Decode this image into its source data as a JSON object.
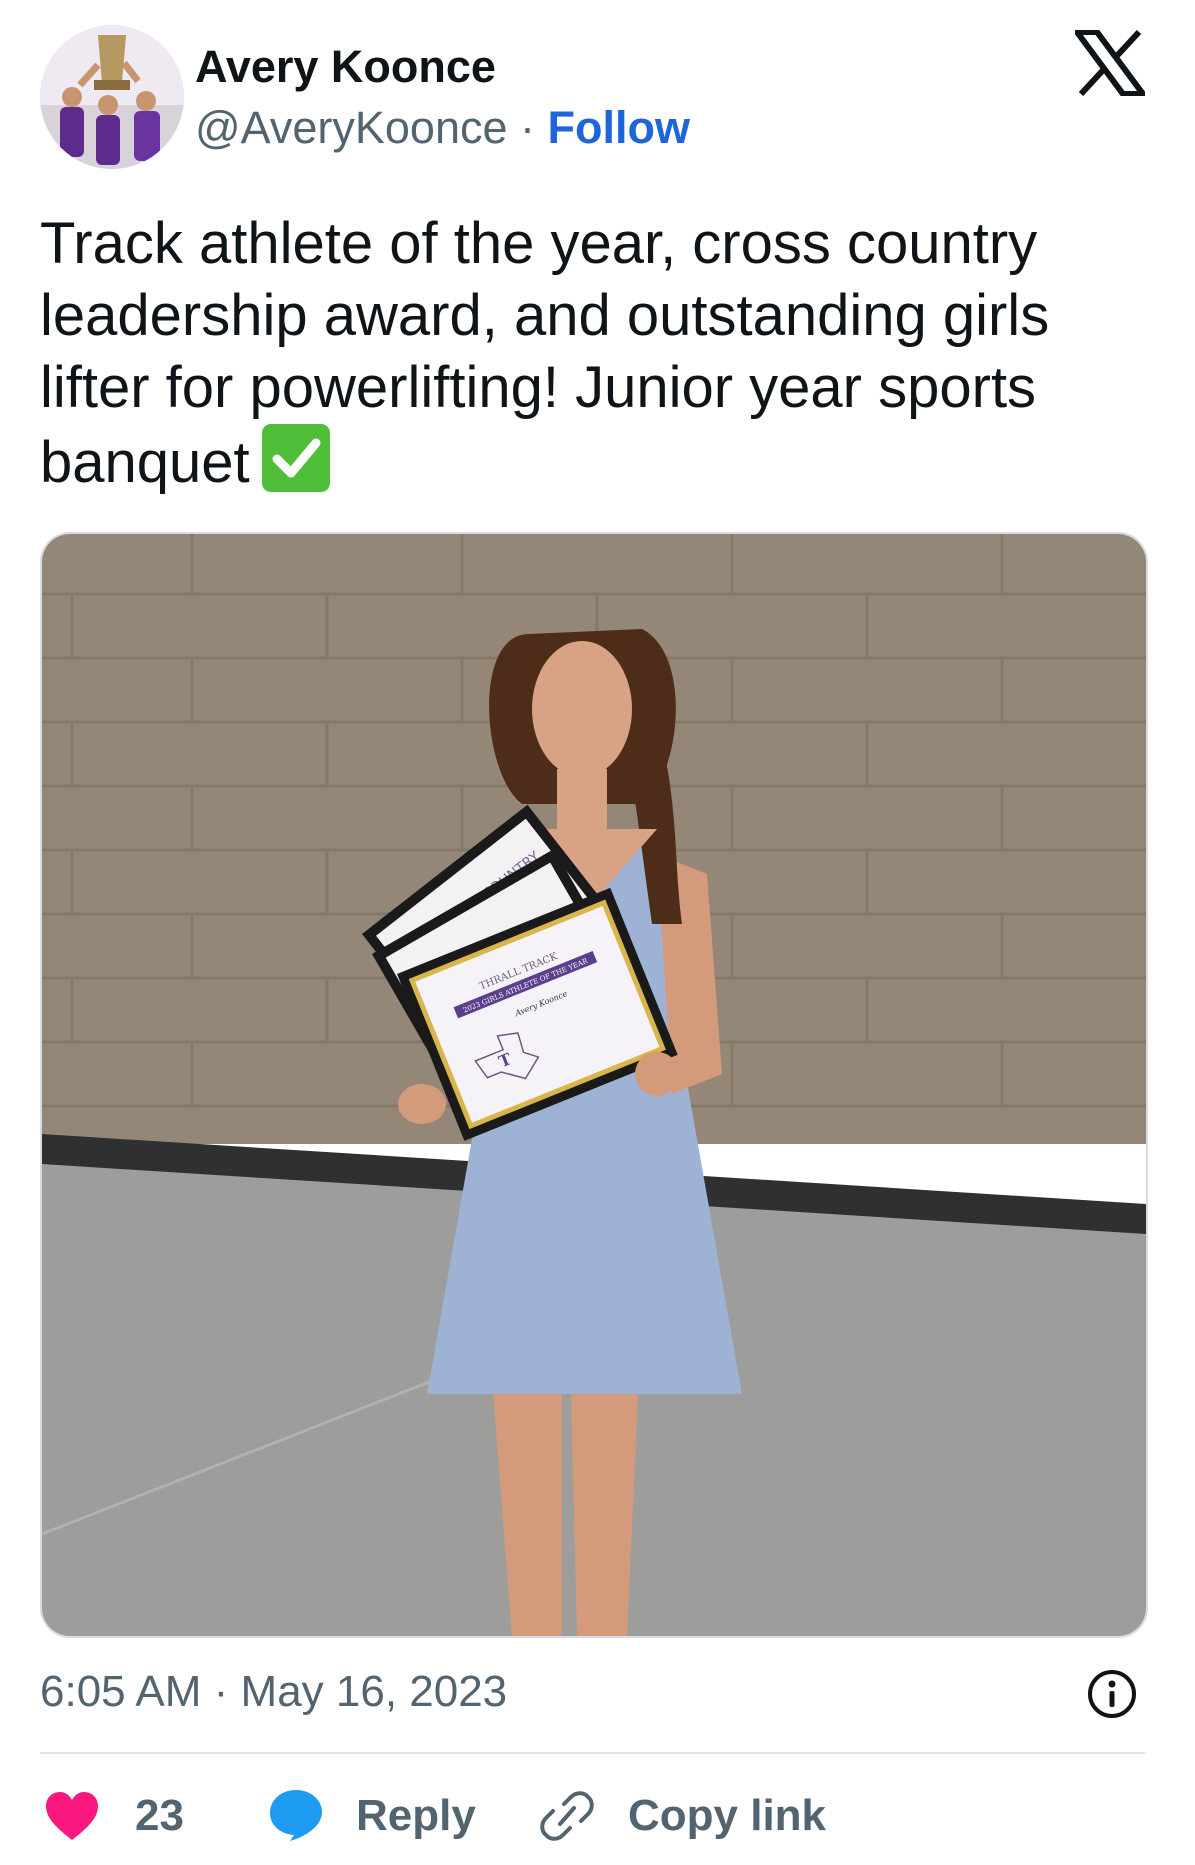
{
  "author": {
    "name": "Avery Koonce",
    "handle": "@AveryKoonce",
    "separator": " · ",
    "follow_label": "Follow"
  },
  "tweet": {
    "text": "Track athlete of the year, cross country\nleadership award, and outstanding girls\nlifter for powerlifting! Junior year sports\nbanquet",
    "emoji": "check-mark-button",
    "timestamp": "6:05 AM · May 16, 2023"
  },
  "media": {
    "certificate_lines": [
      "THRALL TRACK",
      "2023 GIRLS ATHLETE OF THE YEAR",
      "Avery Koonce"
    ],
    "back_frame_text": "COUNTRY"
  },
  "actions": {
    "like_count": "23",
    "reply_label": "Reply",
    "copy_link_label": "Copy link"
  },
  "colors": {
    "follow": "#1d65d8",
    "like": "#f91880",
    "reply": "#1d9bf0",
    "muted": "#536471",
    "check": "#4fbf3a",
    "dress": "#9db2d4",
    "wall": "#958777"
  }
}
